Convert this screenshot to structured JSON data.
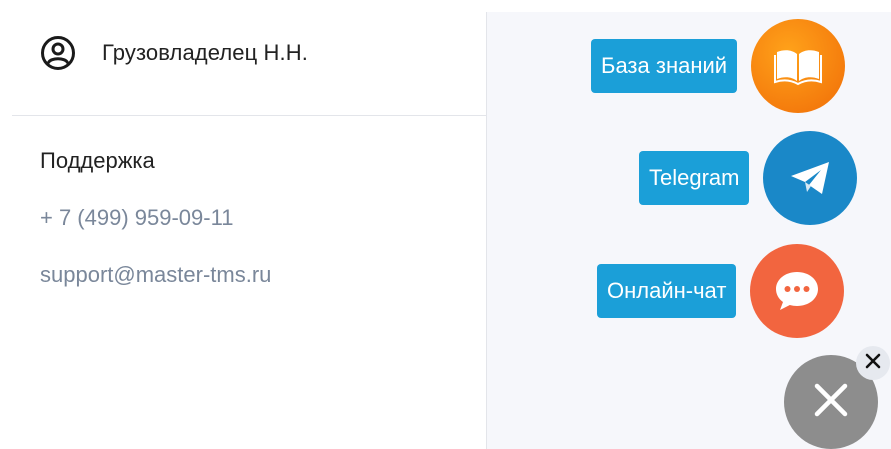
{
  "user": {
    "name": "Грузовладелец Н.Н.",
    "icon": "user-circle-icon"
  },
  "support": {
    "title": "Поддержка",
    "phone": "+ 7 (499) 959-09-11",
    "email": "support@master-tms.ru"
  },
  "widgets": {
    "knowledge_base": {
      "label": "База знаний",
      "icon": "book-icon",
      "color": "#f47a0c"
    },
    "telegram": {
      "label": "Telegram",
      "icon": "paper-plane-icon",
      "color": "#1a88c8"
    },
    "chat": {
      "label": "Онлайн-чат",
      "icon": "chat-bubble-icon",
      "color": "#f2653f"
    },
    "close": {
      "icon": "close-icon",
      "color": "#8d8d8d"
    }
  },
  "colors": {
    "label_bg": "#1b9fd8",
    "link_text": "#7a879a",
    "panel_bg": "#f6f7fb"
  }
}
